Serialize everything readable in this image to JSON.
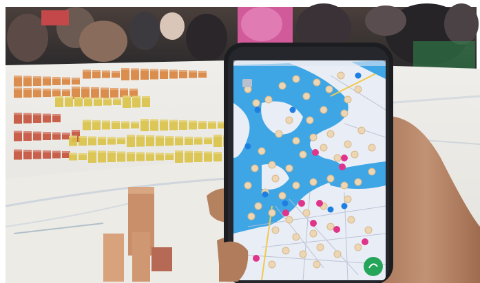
{
  "scene": {
    "description_colors": {
      "frame": "#ffffff",
      "crowd_dark": "#3a2f2c",
      "crowd_pink": "#c8487e",
      "table": "#ecebe6",
      "model_yellow": "#d9c24a",
      "model_orange": "#d9843f",
      "model_red": "#c4543f",
      "block_wood": "#c98f6a",
      "phone_body": "#1c1d21",
      "map_land": "#e9edf6",
      "map_water": "#3fa6e6",
      "pin_beige": "#ecd6b4",
      "pin_magenta": "#e0338a",
      "pin_blue": "#1f7fe0",
      "fab_green": "#25a55a",
      "skin": "#b88565"
    }
  }
}
